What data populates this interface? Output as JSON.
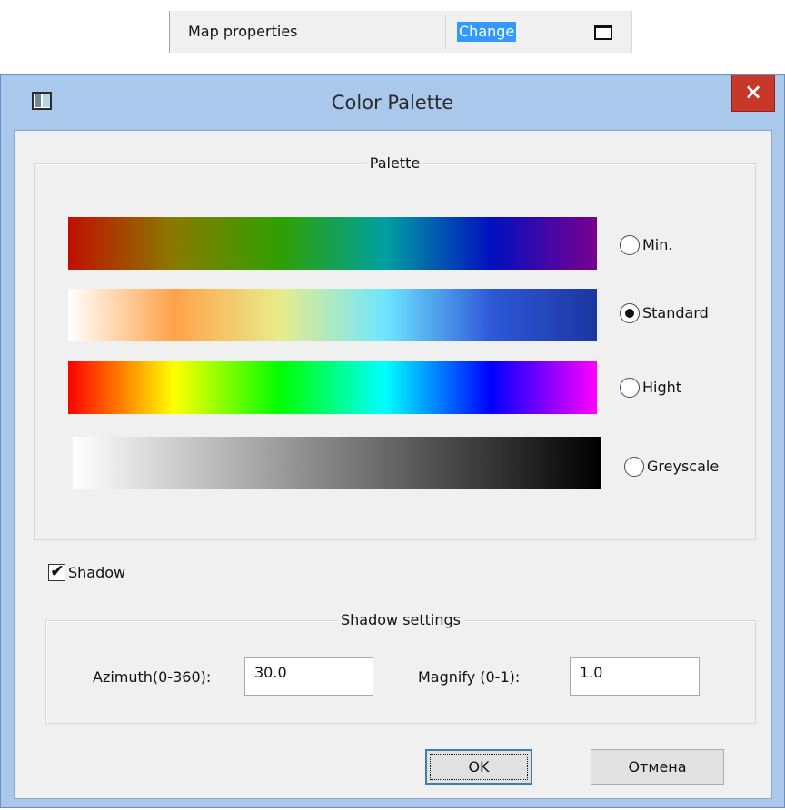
{
  "property_strip": {
    "name": "Map  properties",
    "value": "Change"
  },
  "dialog": {
    "title": "Color Palette",
    "close_label": "×",
    "palette": {
      "title": "Palette",
      "options": [
        {
          "label": "Min.",
          "checked": false,
          "colors": [
            "#c01000",
            "#8a7a00",
            "#2fa000",
            "#00a0a0",
            "#0010c0",
            "#7a0090"
          ]
        },
        {
          "label": "Standard",
          "checked": true,
          "colors": [
            "#ffffff",
            "#ffa24a",
            "#e8ec8a",
            "#6ee6ff",
            "#2e58d8",
            "#1c36a0"
          ]
        },
        {
          "label": "Hight",
          "checked": false,
          "colors": [
            "#ff0000",
            "#ffff00",
            "#00ff00",
            "#00ffff",
            "#0000ff",
            "#ff00ff"
          ]
        },
        {
          "label": "Greyscale",
          "checked": false,
          "colors": [
            "#ffffff",
            "#000000"
          ]
        }
      ]
    },
    "shadow": {
      "label": "Shadow",
      "checked": true
    },
    "shadow_settings": {
      "title": "Shadow settings",
      "azimuth_label": "Azimuth(0-360):",
      "azimuth_value": "30.0",
      "magnify_label": "Magnify (0-1):",
      "magnify_value": "1.0"
    },
    "buttons": {
      "ok": "OK",
      "cancel": "Отмена"
    }
  }
}
